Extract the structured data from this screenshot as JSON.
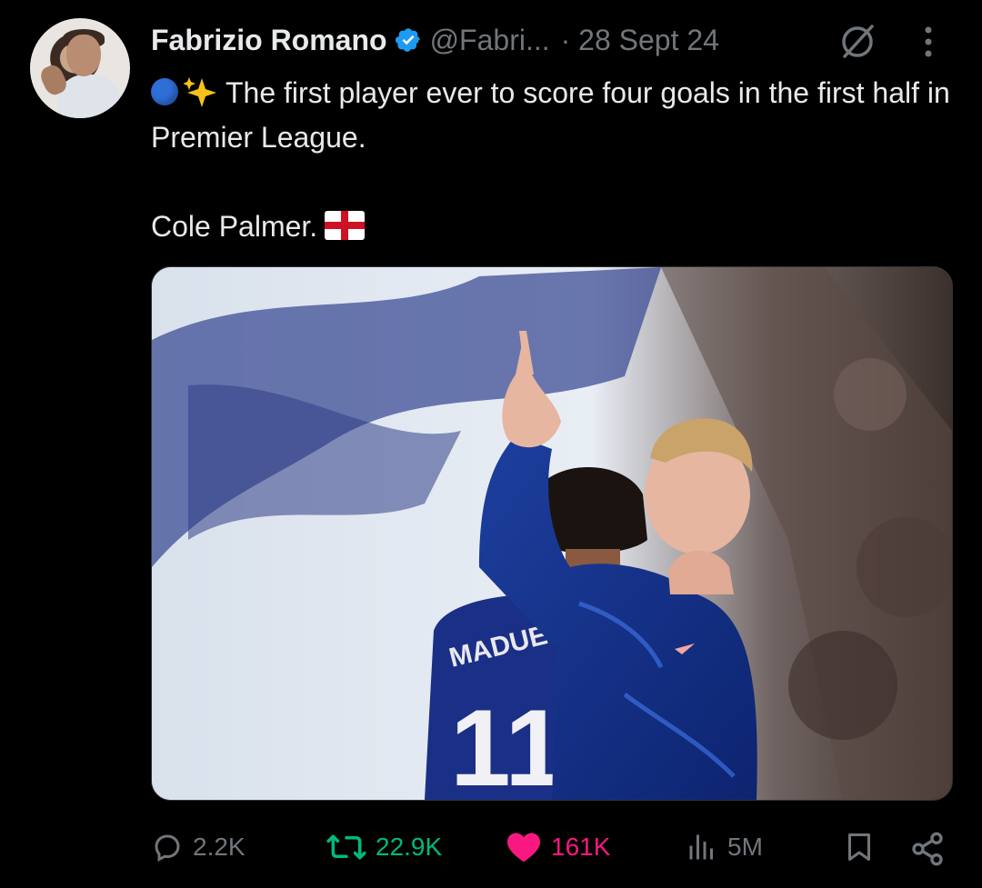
{
  "tweet": {
    "author_name": "Fabrizio Romano",
    "author_handle": "@Fabri...",
    "date": "· 28 Sept 24",
    "text_line1": "The first player ever to score four goals in the first half in Premier League.",
    "text_line2": "Cole Palmer.",
    "emojis": [
      "blue-circle",
      "sparkles",
      "england-flag"
    ]
  },
  "media": {
    "image_text_name": "MADUEKE",
    "image_text_number": "11"
  },
  "actions": {
    "reply_count": "2.2K",
    "retweet_count": "22.9K",
    "like_count": "161K",
    "views_count": "5M"
  },
  "icons": [
    "verified-badge-icon",
    "grok-icon",
    "more-icon",
    "reply-icon",
    "retweet-icon",
    "like-icon",
    "views-icon",
    "bookmark-icon",
    "share-icon"
  ],
  "colors": {
    "background": "#000000",
    "text": "#e7e9ea",
    "muted": "#71767b",
    "verified": "#1d9bf0",
    "retweet": "#00ba7c",
    "like": "#f91880"
  }
}
